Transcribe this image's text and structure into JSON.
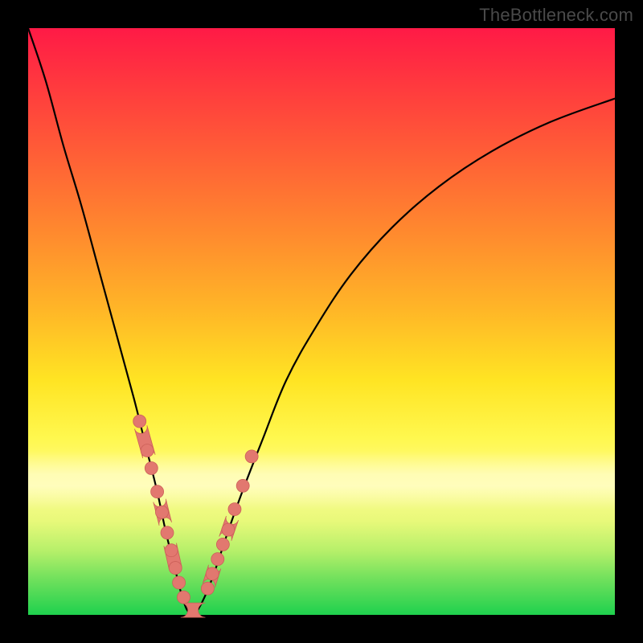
{
  "watermark": "TheBottleneck.com",
  "chart_data": {
    "type": "line",
    "title": "",
    "xlabel": "",
    "ylabel": "",
    "xlim": [
      0,
      100
    ],
    "ylim": [
      0,
      100
    ],
    "grid": false,
    "legend": null,
    "gradient_stops": [
      {
        "pos": 0,
        "color": "#ff1a46"
      },
      {
        "pos": 10,
        "color": "#ff3a3e"
      },
      {
        "pos": 22,
        "color": "#ff6036"
      },
      {
        "pos": 35,
        "color": "#ff8a2e"
      },
      {
        "pos": 48,
        "color": "#ffb627"
      },
      {
        "pos": 60,
        "color": "#ffe423"
      },
      {
        "pos": 70,
        "color": "#fff84f"
      },
      {
        "pos": 78,
        "color": "#fffb8e"
      },
      {
        "pos": 84,
        "color": "#e8f97a"
      },
      {
        "pos": 89,
        "color": "#b7f06a"
      },
      {
        "pos": 94,
        "color": "#6fe05c"
      },
      {
        "pos": 100,
        "color": "#1fd14e"
      }
    ],
    "series": [
      {
        "name": "left",
        "x": [
          0,
          3,
          6,
          9,
          12,
          15,
          18,
          20,
          22,
          23.5,
          25,
          26,
          27,
          28
        ],
        "y": [
          100,
          91,
          80,
          70,
          59,
          48,
          37,
          29,
          21,
          14,
          8,
          4,
          1,
          0
        ]
      },
      {
        "name": "right",
        "x": [
          28,
          29,
          30.5,
          32,
          34,
          36.5,
          40,
          44,
          49,
          55,
          62,
          70,
          79,
          89,
          100
        ],
        "y": [
          0,
          1,
          4,
          8,
          14,
          21,
          30,
          40,
          49,
          58,
          66,
          73,
          79,
          84,
          88
        ]
      }
    ],
    "bead_left": {
      "x": [
        19.0,
        20.3,
        21.0,
        22.0,
        22.8,
        23.7,
        24.4,
        25.1,
        25.7,
        26.5
      ],
      "y": [
        33.0,
        28.0,
        25.0,
        21.0,
        17.5,
        14.0,
        11.0,
        8.0,
        5.5,
        3.0
      ]
    },
    "bead_right": {
      "x": [
        30.6,
        31.4,
        32.3,
        33.2,
        34.1,
        35.2,
        36.6,
        38.1
      ],
      "y": [
        4.5,
        7.0,
        9.5,
        12.0,
        14.5,
        18.0,
        22.0,
        27.0
      ]
    },
    "pills": [
      {
        "x1": 19.2,
        "y1": 32.0,
        "x2": 20.6,
        "y2": 27.0
      },
      {
        "x1": 22.4,
        "y1": 19.5,
        "x2": 23.4,
        "y2": 15.5
      },
      {
        "x1": 24.2,
        "y1": 12.0,
        "x2": 25.1,
        "y2": 8.0
      },
      {
        "x1": 30.8,
        "y1": 5.0,
        "x2": 31.8,
        "y2": 8.2
      },
      {
        "x1": 33.6,
        "y1": 13.0,
        "x2": 34.8,
        "y2": 16.5
      }
    ],
    "bottom_pill": {
      "x1": 26.0,
      "y1": 0.8,
      "x2": 30.2,
      "y2": 0.8
    }
  }
}
